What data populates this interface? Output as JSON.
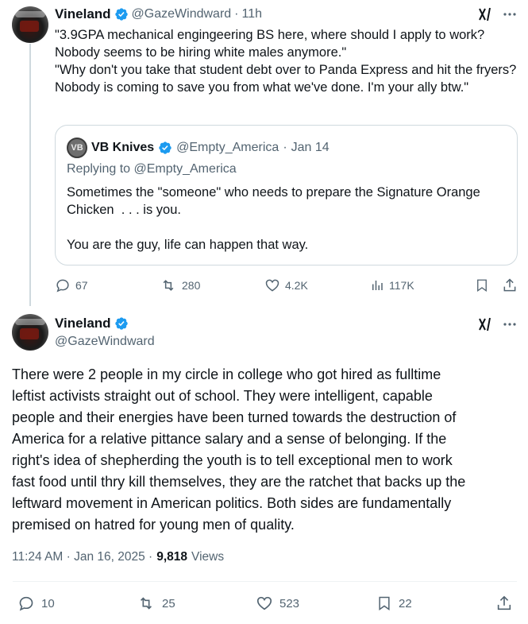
{
  "reply_tweet": {
    "author_name": "Vineland",
    "author_handle": "@GazeWindward",
    "separator": "·",
    "time": "11h",
    "text": "\"3.9GPA mechanical engingeering BS here, where should I apply to work? Nobody seems to be hiring white males anymore.\"\n\"Why don't you take that student debt over to Panda Express and hit the fryers? Nobody is coming to save you from what we've done. I'm your ally btw.\"",
    "quote": {
      "avatar_text": "VB",
      "author_name": "VB Knives",
      "author_handle": "@Empty_America",
      "separator": "·",
      "time": "Jan 14",
      "replying_prefix": "Replying to",
      "replying_handle": "@Empty_America",
      "text": "Sometimes the \"someone\" who needs to prepare the Signature Orange Chicken  . . . is you.\n\nYou are the guy, life can happen that way."
    },
    "stats": {
      "replies": "67",
      "reposts": "280",
      "likes": "4.2K",
      "views": "117K"
    }
  },
  "main_tweet": {
    "author_name": "Vineland",
    "author_handle": "@GazeWindward",
    "text": "There were 2 people in my circle in college who got hired as fulltime\nleftist activists straight out of school. They were intelligent, capable\npeople and their energies have been turned towards the destruction of\nAmerica for a relative pittance salary and a sense of belonging. If the\nright's idea of shepherding the youth is to tell exceptional men to work\nfast food until thry kill themselves, they are the ratchet that backs up the\nleftward movement in American politics. Both sides are fundamentally\npremised on hatred for young men of quality.",
    "timestamp": "11:24 AM · Jan 16, 2025 ·",
    "views_count": "9,818",
    "views_label": "Views",
    "stats": {
      "replies": "10",
      "reposts": "25",
      "likes": "523",
      "bookmarks": "22"
    }
  },
  "icons": {
    "verified": "verified-badge-icon",
    "grok": "grok-icon",
    "more": "more-icon",
    "reply": "reply-icon",
    "repost": "repost-icon",
    "like": "like-icon",
    "views": "views-icon",
    "bookmark": "bookmark-icon",
    "share": "share-icon"
  },
  "colors": {
    "verified_blue": "#1d9bf0",
    "text": "#0f1419",
    "muted": "#536471",
    "border": "#cfd9de"
  }
}
